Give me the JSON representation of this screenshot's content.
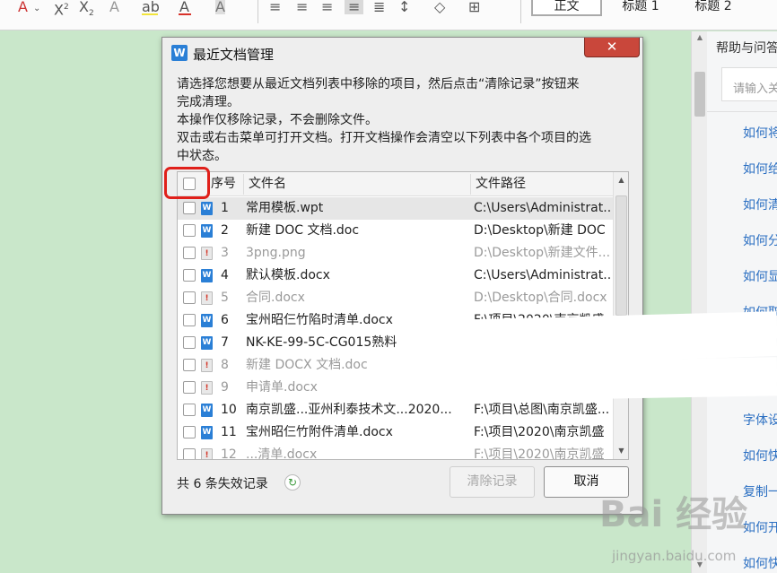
{
  "toolbar": {
    "icons": [
      "font-color-a-icon",
      "superscript-icon",
      "subscript-icon",
      "clear-format-icon",
      "highlight-icon",
      "font-color-icon",
      "char-shading-icon",
      "align-left-icon",
      "align-center-icon",
      "align-right-icon",
      "justify-icon",
      "distributed-icon",
      "line-spacing-icon",
      "shading-icon",
      "border-icon"
    ],
    "styles": [
      "正文",
      "标题 1",
      "标题 2"
    ],
    "highlight_color": "#f2e43a",
    "font_color": "#d8322a"
  },
  "help": {
    "title": "帮助与问答",
    "search_placeholder": "请输入关",
    "links": [
      "如何将",
      "如何给",
      "如何清",
      "如何分",
      "如何显",
      "如何取",
      "字体设",
      "如何快",
      "复制一",
      "如何开",
      "如何快"
    ]
  },
  "dialog": {
    "title": "最近文档管理",
    "close": "✕",
    "message_lines": [
      "请选择您想要从最近文档列表中移除的项目，然后点击“清除记录”按钮来",
      "完成清理。",
      "本操作仅移除记录，不会删除文件。",
      "双击或右击菜单可打开文档。打开文档操作会清空以下列表中各个项目的选",
      "中状态。"
    ],
    "columns": {
      "index": "序号",
      "name": "文件名",
      "path": "文件路径"
    },
    "rows": [
      {
        "no": "1",
        "name": "常用模板.wpt",
        "path": "C:\\Users\\Administrat...",
        "valid": true
      },
      {
        "no": "2",
        "name": "新建 DOC 文档.doc",
        "path": "D:\\Desktop\\新建 DOC",
        "valid": true
      },
      {
        "no": "3",
        "name": "3png.png",
        "path": "D:\\Desktop\\新建文件...",
        "valid": false
      },
      {
        "no": "4",
        "name": "默认模板.docx",
        "path": "C:\\Users\\Administrat...",
        "valid": true
      },
      {
        "no": "5",
        "name": "合同.docx",
        "path": "D:\\Desktop\\合同.docx",
        "valid": false
      },
      {
        "no": "6",
        "name": "宝州昭仨竹陷时清单.docx",
        "path": "F:\\项目\\2020\\南京凯盛",
        "valid": true
      },
      {
        "no": "7",
        "name": "NK-KE-99-5C-CG015熟料",
        "path": "",
        "valid": true
      },
      {
        "no": "8",
        "name": "新建 DOCX 文档.doc",
        "path": "",
        "valid": false
      },
      {
        "no": "9",
        "name": "申请单.docx",
        "path": "",
        "valid": false
      },
      {
        "no": "10",
        "name": "南京凯盛...亚州利泰技术文...2020...",
        "path": "F:\\项目\\总图\\南京凯盛...",
        "valid": true
      },
      {
        "no": "11",
        "name": "宝州昭仨竹附件清单.docx",
        "path": "F:\\项目\\2020\\南京凯盛",
        "valid": true
      },
      {
        "no": "12",
        "name": "...清单.docx",
        "path": "F:\\项目\\2020\\南京凯盛",
        "valid": false
      }
    ],
    "invalid_count": "共 6 条失效记录",
    "refresh_icon": "refresh-icon",
    "clear_label": "清除记录",
    "cancel_label": "取消"
  },
  "watermark": {
    "logo": "Bai 经验",
    "url": "jingyan.baidu.com"
  }
}
